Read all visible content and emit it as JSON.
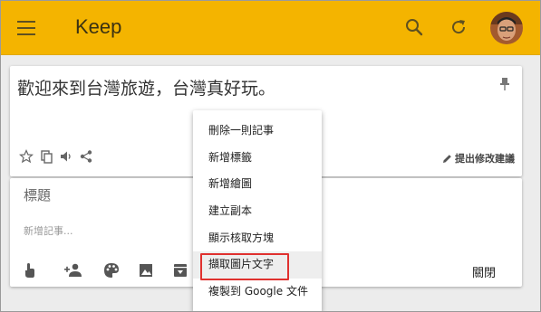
{
  "appbar": {
    "title": "Keep",
    "menu_icon": "hamburger-menu-icon",
    "search_icon": "search-icon",
    "refresh_icon": "refresh-icon",
    "accent_color": "#f4b400"
  },
  "note": {
    "text": "歡迎來到台灣旅遊，台灣真好玩。",
    "pin_icon": "pin-icon",
    "tools": [
      "star-icon",
      "copy-icon",
      "speaker-icon",
      "share-icon"
    ],
    "suggest_label": "提出修改建議"
  },
  "new_note": {
    "title_placeholder": "標題",
    "body_placeholder": "新增記事...",
    "tools": [
      "touch-icon",
      "add-person-icon",
      "palette-icon",
      "image-icon",
      "archive-icon"
    ],
    "close_label": "關閉"
  },
  "context_menu": {
    "items": [
      "刪除一則記事",
      "新增標籤",
      "新增繪圖",
      "建立副本",
      "顯示核取方塊",
      "擷取圖片文字",
      "複製到 Google 文件"
    ],
    "highlighted_index": 5
  }
}
